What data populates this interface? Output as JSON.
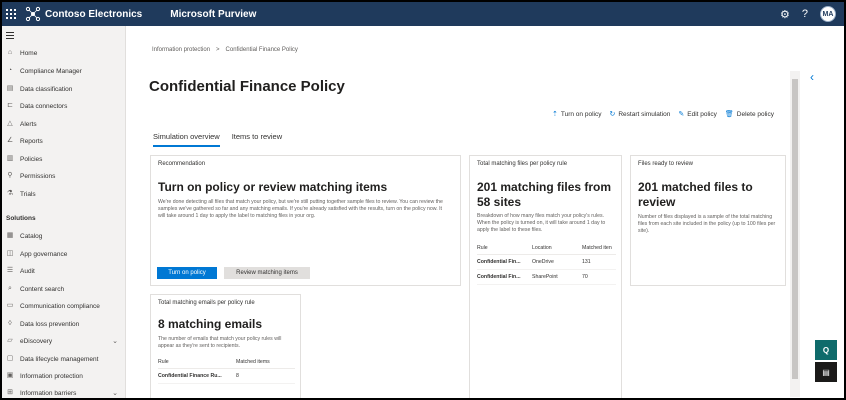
{
  "topbar": {
    "brand": "Contoso Electronics",
    "product": "Microsoft Purview",
    "avatar": "MA",
    "icons": [
      "waffle-icon",
      "gear-icon",
      "help-icon"
    ]
  },
  "nav": {
    "items": [
      {
        "label": "Home",
        "icon": "home-icon"
      },
      {
        "label": "Compliance Manager",
        "icon": "compliance-icon"
      },
      {
        "label": "Data classification",
        "icon": "classification-icon"
      },
      {
        "label": "Data connectors",
        "icon": "connector-icon"
      },
      {
        "label": "Alerts",
        "icon": "alert-icon"
      },
      {
        "label": "Reports",
        "icon": "reports-icon"
      },
      {
        "label": "Policies",
        "icon": "policies-icon"
      },
      {
        "label": "Permissions",
        "icon": "permissions-icon"
      },
      {
        "label": "Trials",
        "icon": "trials-icon"
      }
    ],
    "section_label": "Solutions",
    "solutions": [
      {
        "label": "Catalog"
      },
      {
        "label": "App governance"
      },
      {
        "label": "Audit"
      },
      {
        "label": "Content search"
      },
      {
        "label": "Communication compliance"
      },
      {
        "label": "Data loss prevention"
      },
      {
        "label": "eDiscovery",
        "expandable": true
      },
      {
        "label": "Data lifecycle management"
      },
      {
        "label": "Information protection"
      },
      {
        "label": "Information barriers",
        "expandable": true
      }
    ]
  },
  "breadcrumb": {
    "items": [
      "Information protection",
      "Confidential Finance Policy"
    ],
    "separator": ">"
  },
  "page": {
    "title": "Confidential Finance Policy"
  },
  "commands": {
    "turn_on": "Turn on policy",
    "restart": "Restart simulation",
    "edit": "Edit policy",
    "delete": "Delete policy"
  },
  "tabs": [
    {
      "label": "Simulation overview",
      "active": true
    },
    {
      "label": "Items to review",
      "active": false
    }
  ],
  "recommendation": {
    "header": "Recommendation",
    "title": "Turn on policy or review matching items",
    "desc": "We're done detecting all files that match your policy, but we're still putting together sample files to review. You can review the samples we've gathered so far and any matching emails. If you're already satisfied with the results, turn on the policy now. It will take around 1 day to apply the label to matching files in your org.",
    "primary_btn": "Turn on policy",
    "secondary_btn": "Review matching items"
  },
  "files_card": {
    "header": "Total matching files per policy rule",
    "title": "201 matching files from 58 sites",
    "desc": "Breakdown of how many files match your policy's rules. When the policy is turned on, it will take around 1 day to apply the label to these files.",
    "columns": [
      "Rule",
      "Location",
      "Matched iten"
    ],
    "rows": [
      {
        "rule": "Confidential Fin...",
        "location": "OneDrive",
        "matched": "131"
      },
      {
        "rule": "Confidential Fin...",
        "location": "SharePoint",
        "matched": "70"
      }
    ]
  },
  "ready_card": {
    "header": "Files ready to review",
    "title": "201 matched files to review",
    "desc": "Number of files displayed is a sample of the total matching files from each site included in the policy (up to 100 files per site)."
  },
  "emails_card": {
    "header": "Total matching emails per policy rule",
    "title": "8 matching emails",
    "desc": "The number of emails that match your policy rules will appear as they're sent to recipients.",
    "columns": [
      "Rule",
      "Matched items"
    ],
    "rows": [
      {
        "rule": "Confidential Finance Ru...",
        "matched": "8"
      }
    ]
  },
  "colors": {
    "topbar": "#1f3a5c",
    "accent": "#0078d4"
  }
}
